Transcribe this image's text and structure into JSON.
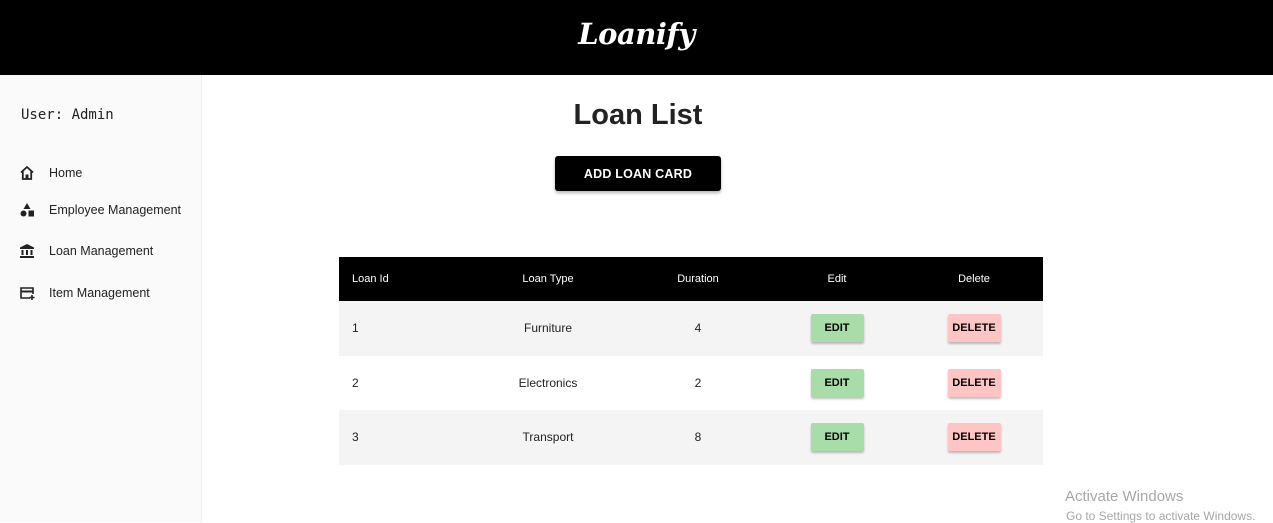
{
  "header": {
    "brand": "Loanify"
  },
  "sidebar": {
    "user_label": "User: Admin",
    "items": [
      {
        "label": "Home",
        "icon": "home-icon"
      },
      {
        "label": "Employee Management",
        "icon": "shapes-icon"
      },
      {
        "label": "Loan Management",
        "icon": "bank-icon"
      },
      {
        "label": "Item Management",
        "icon": "card-add-icon"
      }
    ]
  },
  "main": {
    "title": "Loan List",
    "add_button": "ADD LOAN CARD",
    "table": {
      "headers": [
        "Loan Id",
        "Loan Type",
        "Duration",
        "Edit",
        "Delete"
      ],
      "rows": [
        {
          "id": "1",
          "type": "Furniture",
          "duration": "4"
        },
        {
          "id": "2",
          "type": "Electronics",
          "duration": "2"
        },
        {
          "id": "3",
          "type": "Transport",
          "duration": "8"
        }
      ],
      "edit_label": "EDIT",
      "delete_label": "DELETE"
    }
  },
  "watermark": {
    "line1": "Activate Windows",
    "line2": "Go to Settings to activate Windows."
  },
  "colors": {
    "topbar": "#000000",
    "edit_button": "#a8dca8",
    "delete_button": "#ffc4c4",
    "row_stripe": "#f4f4f4"
  }
}
